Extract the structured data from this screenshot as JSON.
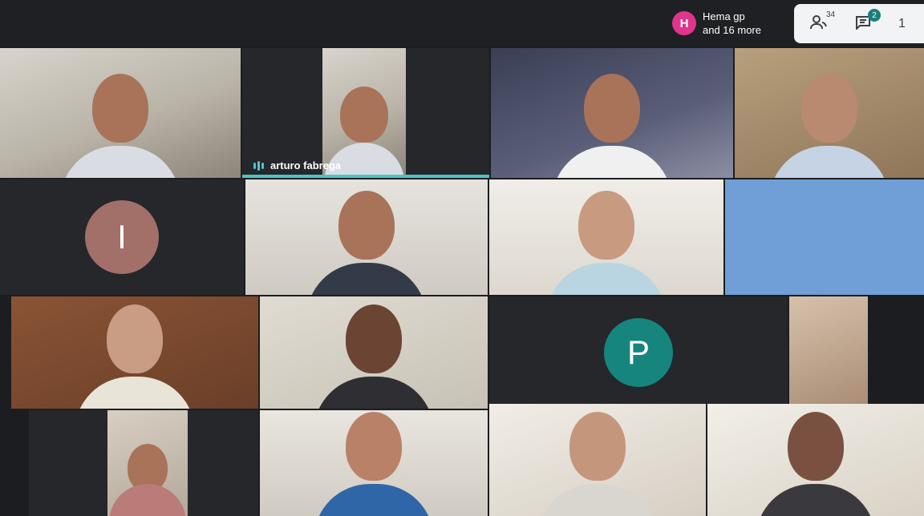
{
  "presence": {
    "initial": "H",
    "line1": "Hema gp",
    "line2": "and 16 more",
    "color": "#e0358d"
  },
  "controls": {
    "people_count": "34",
    "chat_badge": "2",
    "clock_fragment": "1"
  },
  "tiles": [
    {
      "name": "participant-video"
    },
    {
      "name": "arturo fabrega"
    },
    {
      "name": "participant-video"
    },
    {
      "name": "participant-video"
    },
    {
      "initial": "I",
      "color": "#a36f69"
    },
    {
      "name": "participant-video"
    },
    {
      "name": "participant-video"
    },
    {
      "name": "participant-video"
    },
    {
      "name": "participant-video"
    },
    {
      "initial": "P",
      "color": "#16857d"
    },
    {
      "name": "participant-video"
    },
    {
      "name": "participant-video"
    },
    {
      "name": "participant-video"
    },
    {
      "name": "participant-video"
    },
    {
      "name": "participant-video"
    }
  ],
  "active_speaker": {
    "label": "arturo fabrega"
  }
}
